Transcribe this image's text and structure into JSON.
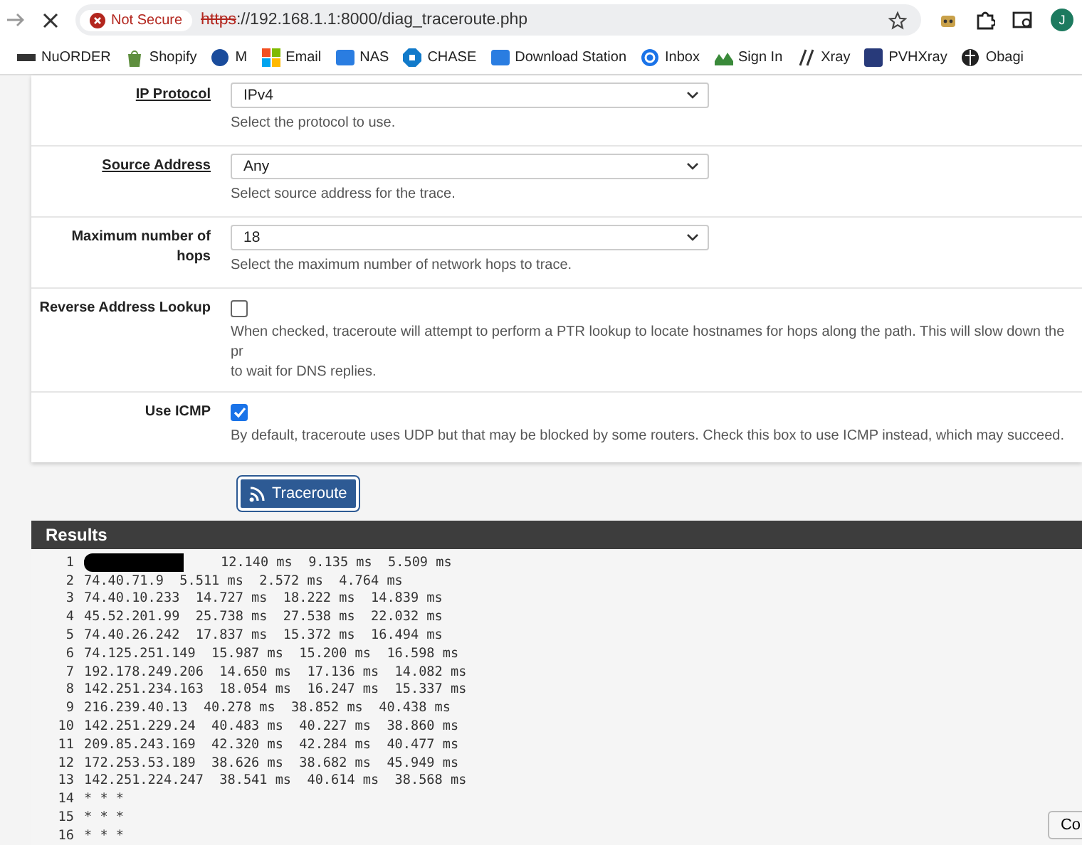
{
  "browser": {
    "security": "Not Secure",
    "url_scheme": "https",
    "url_rest": "://192.168.1.1:8000/diag_traceroute.php",
    "avatar": "J"
  },
  "bookmarks": [
    {
      "label": "NuORDER",
      "kind": "text-logo"
    },
    {
      "label": "Shopify",
      "kind": "bag"
    },
    {
      "label": "M",
      "kind": "circle"
    },
    {
      "label": "Email",
      "kind": "squares"
    },
    {
      "label": "NAS",
      "kind": "dsm"
    },
    {
      "label": "CHASE",
      "kind": "octagon"
    },
    {
      "label": "Download Station",
      "kind": "dsm"
    },
    {
      "label": "Inbox",
      "kind": "ring"
    },
    {
      "label": "Sign In",
      "kind": "grass"
    },
    {
      "label": "Xray",
      "kind": "slash"
    },
    {
      "label": "PVHXray",
      "kind": "square-dark"
    },
    {
      "label": "Obagi",
      "kind": "globe"
    }
  ],
  "form": [
    {
      "kind": "select",
      "label": "IP Protocol",
      "link": true,
      "value": "IPv4",
      "help": [
        "Select the protocol to use."
      ]
    },
    {
      "kind": "select",
      "label": "Source Address",
      "link": true,
      "value": "Any",
      "help": [
        "Select source address for the trace."
      ]
    },
    {
      "kind": "select",
      "label": "Maximum number of hops",
      "link": false,
      "value": "18",
      "help": [
        "Select the maximum number of network hops to trace."
      ]
    },
    {
      "kind": "checkbox",
      "label": "Reverse Address Lookup",
      "checked": false,
      "help": [
        "When checked, traceroute will attempt to perform a PTR lookup to locate hostnames for hops along the path. This will slow down the pr",
        "to wait for DNS replies."
      ]
    },
    {
      "kind": "checkbox",
      "label": "Use ICMP",
      "checked": true,
      "help": [
        "By default, traceroute uses UDP but that may be blocked by some routers. Check this box to use ICMP instead, which may succeed."
      ]
    }
  ],
  "action": "Traceroute",
  "results": {
    "title": "Results",
    "hops": [
      {
        "num": "1",
        "redacted": true,
        "line": "12.140 ms  9.135 ms  5.509 ms"
      },
      {
        "num": "2",
        "redacted": false,
        "line": "74.40.71.9  5.511 ms  2.572 ms  4.764 ms"
      },
      {
        "num": "3",
        "redacted": false,
        "line": "74.40.10.233  14.727 ms  18.222 ms  14.839 ms"
      },
      {
        "num": "4",
        "redacted": false,
        "line": "45.52.201.99  25.738 ms  27.538 ms  22.032 ms"
      },
      {
        "num": "5",
        "redacted": false,
        "line": "74.40.26.242  17.837 ms  15.372 ms  16.494 ms"
      },
      {
        "num": "6",
        "redacted": false,
        "line": "74.125.251.149  15.987 ms  15.200 ms  16.598 ms"
      },
      {
        "num": "7",
        "redacted": false,
        "line": "192.178.249.206  14.650 ms  17.136 ms  14.082 ms"
      },
      {
        "num": "8",
        "redacted": false,
        "line": "142.251.234.163  18.054 ms  16.247 ms  15.337 ms"
      },
      {
        "num": "9",
        "redacted": false,
        "line": "216.239.40.13  40.278 ms  38.852 ms  40.438 ms"
      },
      {
        "num": "10",
        "redacted": false,
        "line": "142.251.229.24  40.483 ms  40.227 ms  38.860 ms"
      },
      {
        "num": "11",
        "redacted": false,
        "line": "209.85.243.169  42.320 ms  42.284 ms  40.477 ms"
      },
      {
        "num": "12",
        "redacted": false,
        "line": "172.253.53.189  38.626 ms  38.682 ms  45.949 ms"
      },
      {
        "num": "13",
        "redacted": false,
        "line": "142.251.224.247  38.541 ms  40.614 ms  38.568 ms"
      },
      {
        "num": "14",
        "redacted": false,
        "line": "* * *"
      },
      {
        "num": "15",
        "redacted": false,
        "line": "* * *"
      },
      {
        "num": "16",
        "redacted": false,
        "line": "* * *"
      }
    ],
    "corner_button": "Co"
  }
}
